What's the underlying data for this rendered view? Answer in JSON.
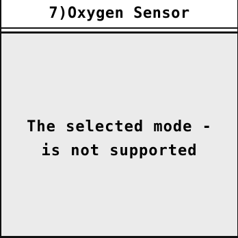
{
  "header": {
    "title": "7)Oxygen Sensor"
  },
  "message": {
    "line1": "The selected mode -",
    "line2": "is not supported"
  }
}
